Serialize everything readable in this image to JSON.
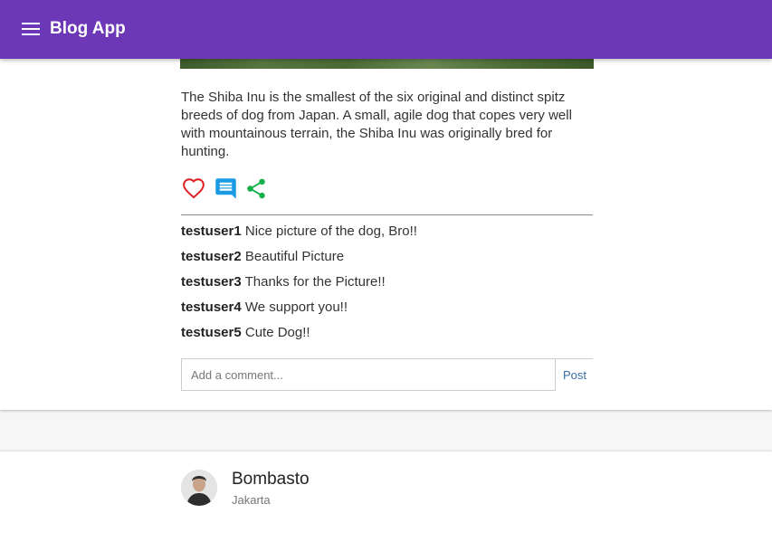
{
  "appbar": {
    "title": "Blog App",
    "menu_icon": "hamburger-menu-icon",
    "color": "#6c38b7"
  },
  "post": {
    "caption": "The Shiba Inu is the smallest of the six original and distinct spitz breeds of dog from Japan. A small, agile dog that copes very well with mountainous terrain, the Shiba Inu was originally bred for hunting.",
    "actions": {
      "like_icon": "heart-outline-icon",
      "comment_icon": "comment-icon",
      "share_icon": "share-icon",
      "like_color": "#e01e1e",
      "comment_color": "#1b9be6",
      "share_color": "#14b14b"
    },
    "comments": [
      {
        "user": "testuser1",
        "text": "Nice picture of the dog, Bro!!"
      },
      {
        "user": "testuser2",
        "text": "Beautiful Picture"
      },
      {
        "user": "testuser3",
        "text": "Thanks for the Picture!!"
      },
      {
        "user": "testuser4",
        "text": "We support you!!"
      },
      {
        "user": "testuser5",
        "text": "Cute Dog!!"
      }
    ],
    "comment_input": {
      "placeholder": "Add a comment...",
      "value": ""
    },
    "post_button": "Post"
  },
  "next_post": {
    "author": "Bombasto",
    "location": "Jakarta"
  }
}
